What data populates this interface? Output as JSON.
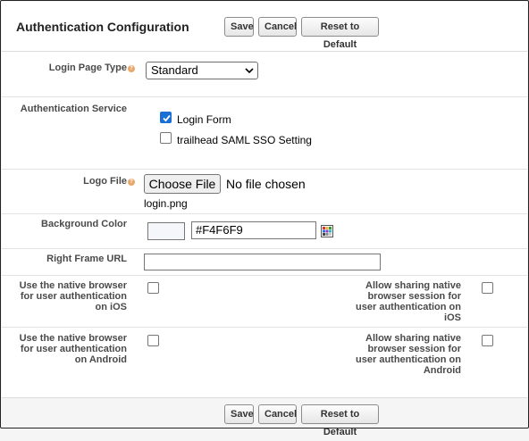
{
  "header": {
    "title": "Authentication Configuration",
    "save_label": "Save",
    "cancel_label": "Cancel",
    "reset_label": "Reset to Default"
  },
  "login_page_type": {
    "label": "Login Page Type",
    "value": "Standard"
  },
  "auth_service": {
    "label": "Authentication Service",
    "options": [
      {
        "label": "Login Form",
        "checked": true
      },
      {
        "label": "trailhead SAML SSO Setting",
        "checked": false
      }
    ]
  },
  "logo_file": {
    "label": "Logo File",
    "button_label": "Choose File",
    "status": "No file chosen",
    "current_file": "login.png"
  },
  "background_color": {
    "label": "Background Color",
    "value": "#F4F6F9"
  },
  "right_frame_url": {
    "label": "Right Frame URL",
    "value": ""
  },
  "native_ios": {
    "label_line1": "Use the native browser",
    "label_line2": "for user authentication",
    "label_line3": "on iOS",
    "checked": false
  },
  "sharing_ios": {
    "label_line1": "Allow sharing native",
    "label_line2": "browser session for",
    "label_line3": "user authentication on",
    "label_line4": "iOS",
    "checked": false
  },
  "native_android": {
    "label_line1": "Use the native browser",
    "label_line2": "for user authentication",
    "label_line3": "on Android",
    "checked": false
  },
  "sharing_android": {
    "label_line1": "Allow sharing native",
    "label_line2": "browser session for",
    "label_line3": "user authentication on",
    "label_line4": "Android",
    "checked": false
  },
  "footer": {
    "save_label": "Save",
    "cancel_label": "Cancel",
    "reset_label": "Reset to Default"
  },
  "colors": {
    "checkbox_accent": "#1a6fd6",
    "help_icon": "#e8a86b"
  },
  "icons": {
    "help": "help-icon",
    "color_picker": "color-picker-icon",
    "chevron": "chevron-down-icon"
  }
}
